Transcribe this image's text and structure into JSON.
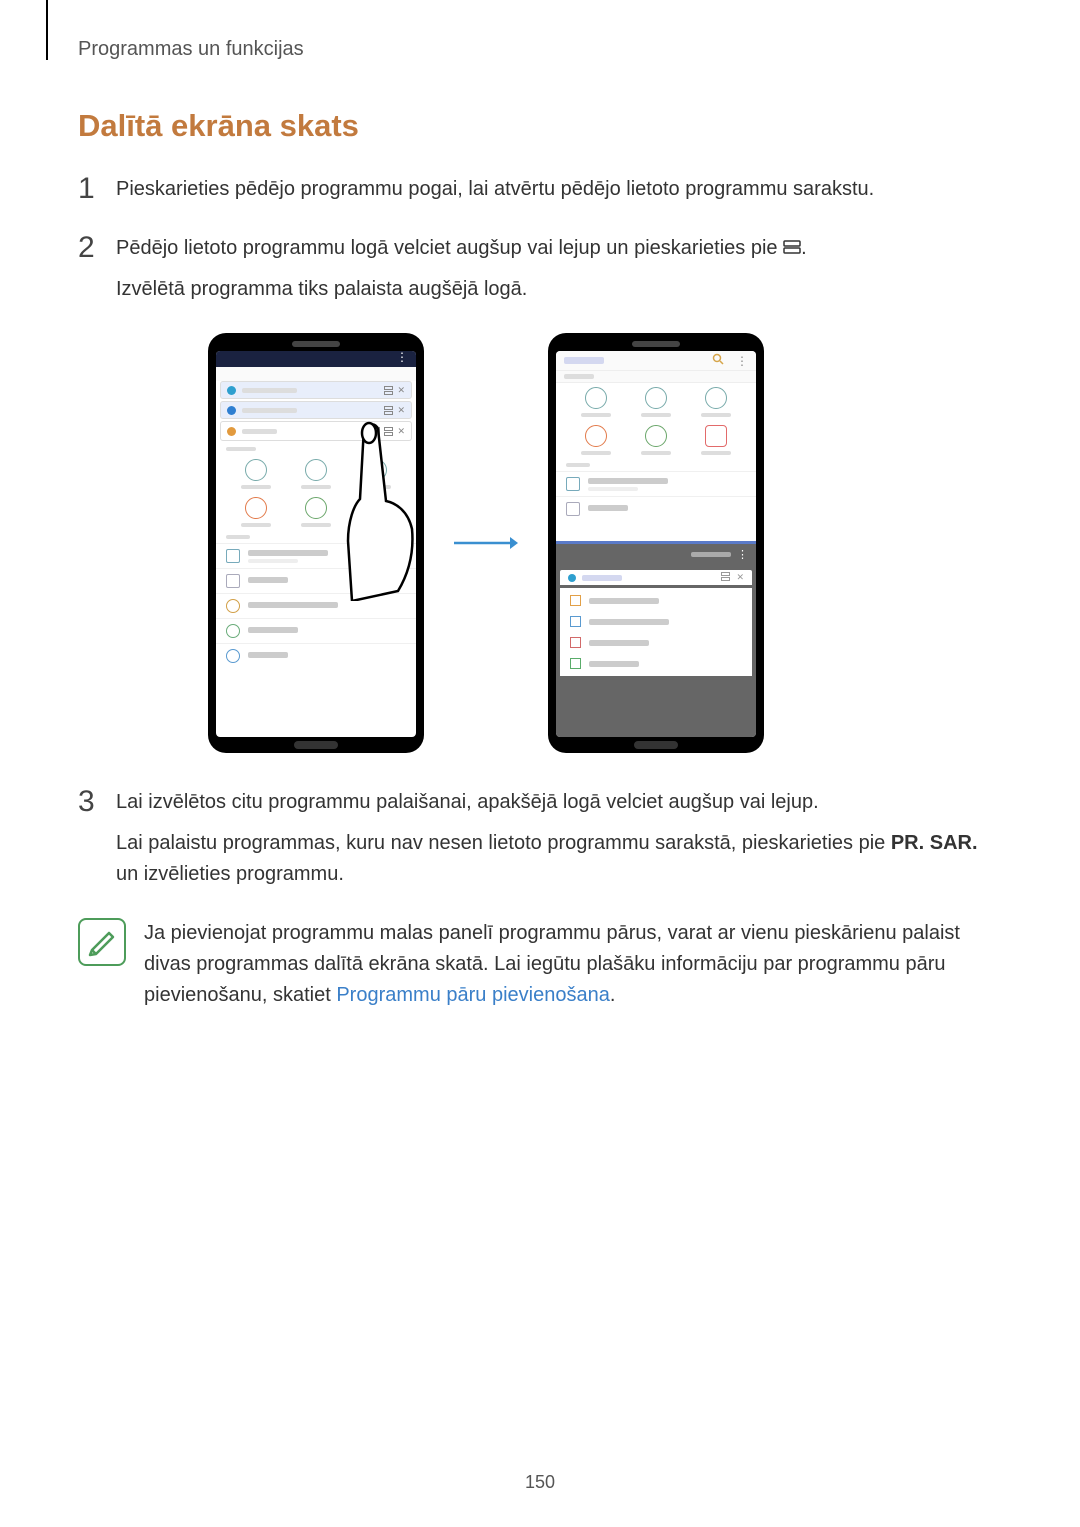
{
  "breadcrumb": "Programmas un funkcijas",
  "section_title": "Dalītā ekrāna skats",
  "steps": {
    "s1": {
      "num": "1",
      "text": "Pieskarieties pēdējo programmu pogai, lai atvērtu pēdējo lietoto programmu sarakstu."
    },
    "s2": {
      "num": "2",
      "line1_a": "Pēdējo lietoto programmu logā velciet augšup vai lejup un pieskarieties pie ",
      "line1_b": ".",
      "line2": "Izvēlētā programma tiks palaista augšējā logā."
    },
    "s3": {
      "num": "3",
      "line1": "Lai izvēlētos citu programmu palaišanai, apakšējā logā velciet augšup vai lejup.",
      "line2_a": "Lai palaistu programmas, kuru nav nesen lietoto programmu sarakstā, pieskarieties pie ",
      "line2_b": "PR. SAR.",
      "line2_c": " un izvēlieties programmu."
    }
  },
  "info": {
    "text_a": "Ja pievienojat programmu malas panelī programmu pārus, varat ar vienu pieskārienu palaist divas programmas dalītā ekrāna skatā. Lai iegūtu plašāku informāciju par programmu pāru pievienošanu, skatiet ",
    "link": "Programmu pāru pievienošana",
    "text_b": "."
  },
  "page_number": "150"
}
